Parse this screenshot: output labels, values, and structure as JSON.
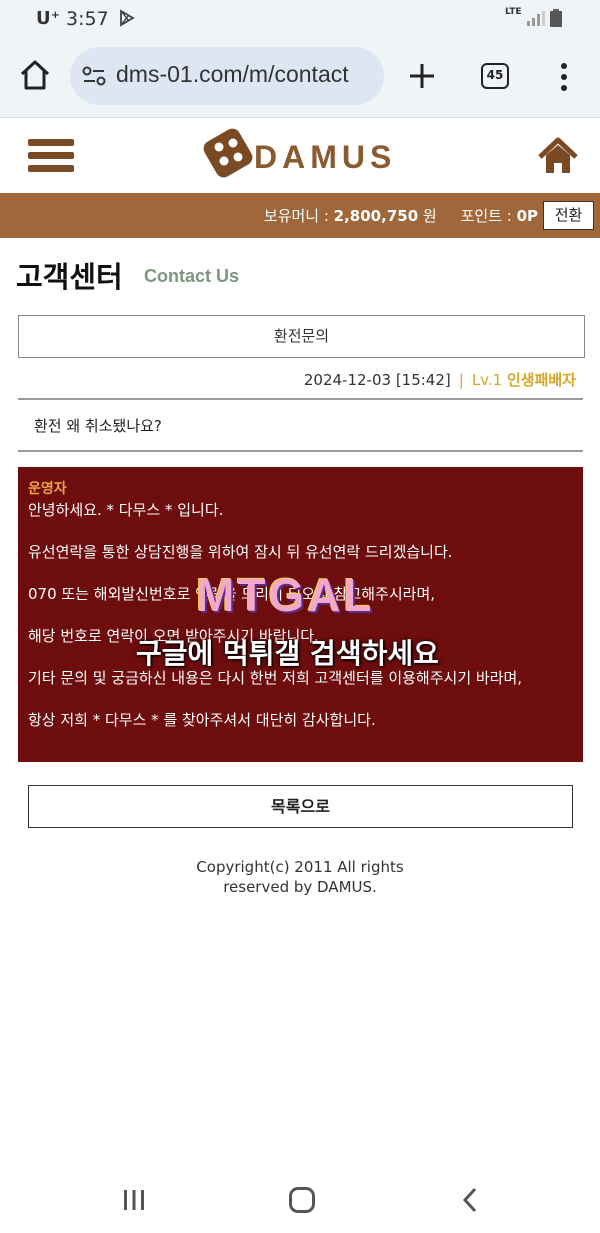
{
  "status_bar": {
    "carrier": "U⁺",
    "time": "3:57",
    "network": "LTE"
  },
  "browser": {
    "url": "dms-01.com/m/contact",
    "tab_count": "45"
  },
  "site": {
    "logo_text": "DAMUS",
    "colors": {
      "brand_brown": "#a0673a",
      "answer_bg": "#6e0d0d",
      "accent_gold": "#d6a728",
      "subtitle_green": "#7c977e"
    }
  },
  "money_bar": {
    "money_label": "보유머니 : ",
    "money_value": "2,800,750",
    "money_unit": " 원",
    "points_label": "포인트 : ",
    "points_value": "0P",
    "switch_label": "전환"
  },
  "page": {
    "title": "고객센터",
    "subtitle": "Contact Us"
  },
  "inquiry": {
    "category": "환전문의",
    "datetime": "2024-12-03 [15:42]",
    "level": "Lv.1",
    "nickname": "인생패배자",
    "question": "환전 왜 취소됐나요?"
  },
  "answer": {
    "author": "운영자",
    "line1": "안녕하세요. * 다무스 * 입니다.",
    "line2": "유선연락을 통한 상담진행을 위하여 잠시 뒤 유선연락 드리겠습니다.",
    "line3": "070 또는 해외발신번호로 연락을 드리게 되오니 참고해주시라며,",
    "line4": "해당 번호로 연락이 오면 받아주시기 바랍니다.",
    "line5": "기타 문의 및 궁금하신 내용은 다시 한번 저희 고객센터를 이용해주시기 바라며,",
    "line6": "항상 저희 * 다무스 * 를 찾아주셔서 대단히 감사합니다."
  },
  "watermark": {
    "logo": "MTGAL",
    "text": "구글에 먹튀갤 검색하세요"
  },
  "buttons": {
    "list": "목록으로"
  },
  "footer": {
    "copyright_line1": "Copyright(c) 2011 All rights",
    "copyright_line2": "reserved by DAMUS."
  }
}
